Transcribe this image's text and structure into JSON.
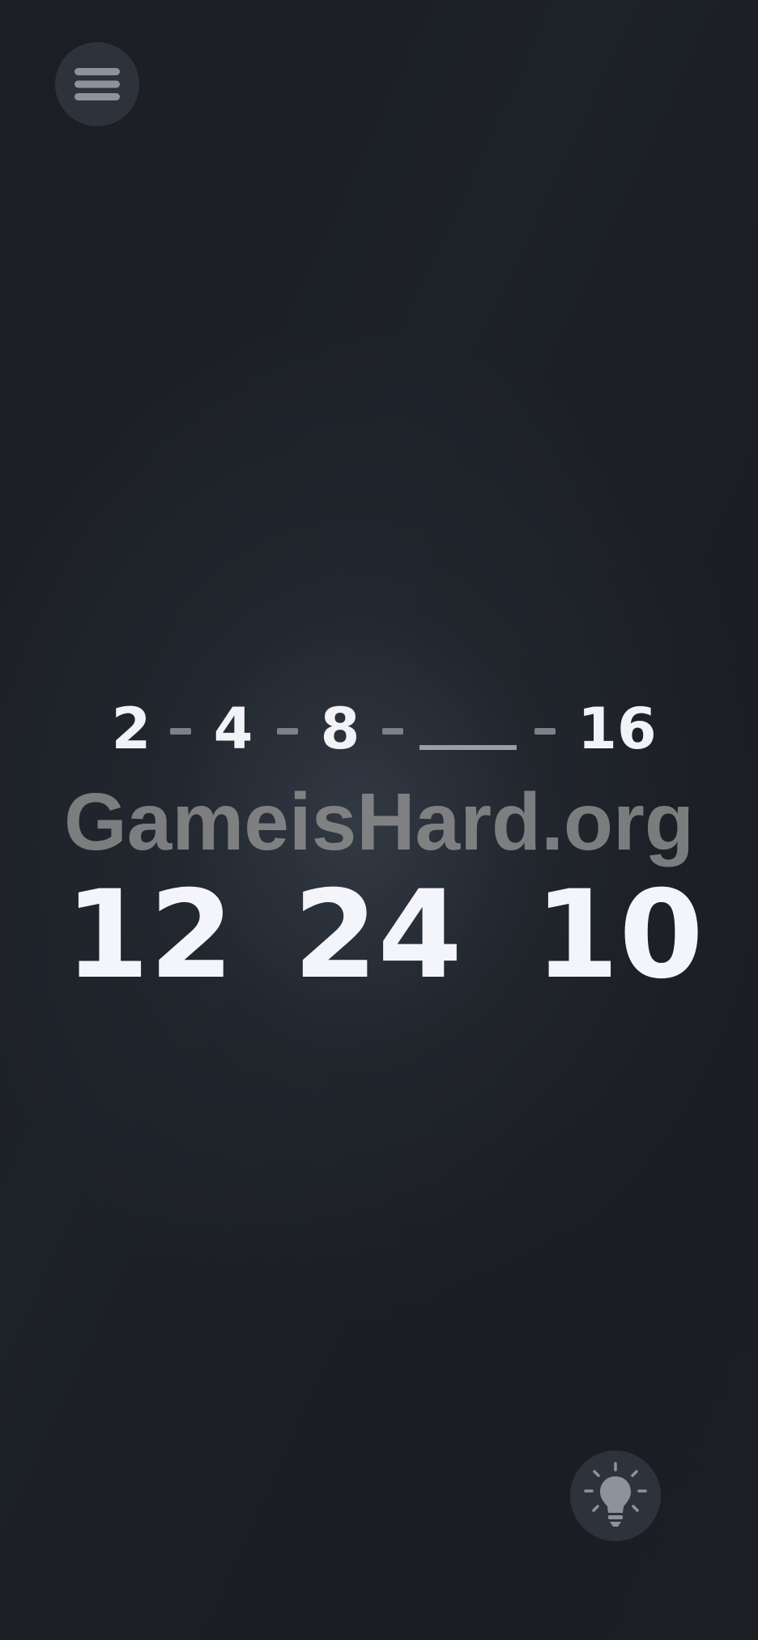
{
  "menu": {
    "icon": "hamburger-menu-icon"
  },
  "puzzle": {
    "sequence": [
      "2",
      "4",
      "8",
      "16"
    ],
    "blank_label": ""
  },
  "watermark": {
    "text": "GameisHard.org"
  },
  "options": [
    "12",
    "24",
    "10"
  ],
  "hint": {
    "icon": "lightbulb-icon"
  },
  "colors": {
    "background": "#1a1d22",
    "button_bg": "#2e333b",
    "number_text": "#f2f3f7",
    "dash": "#7d8188",
    "icon": "#8e939b"
  }
}
